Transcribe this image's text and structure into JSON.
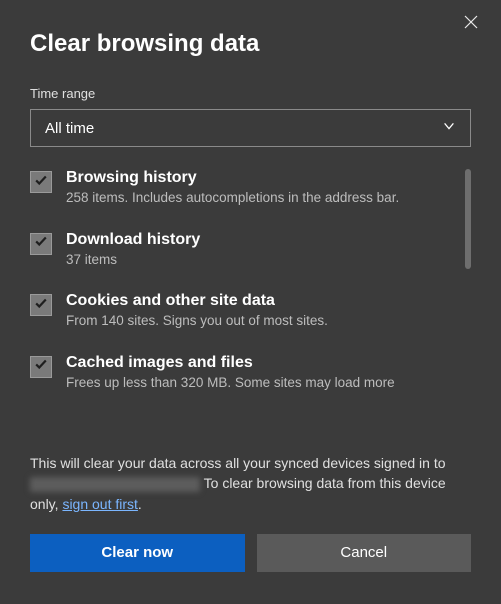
{
  "title": "Clear browsing data",
  "timeRange": {
    "label": "Time range",
    "value": "All time"
  },
  "items": [
    {
      "title": "Browsing history",
      "sub": "258 items. Includes autocompletions in the address bar.",
      "checked": true
    },
    {
      "title": "Download history",
      "sub": "37 items",
      "checked": true
    },
    {
      "title": "Cookies and other site data",
      "sub": "From 140 sites. Signs you out of most sites.",
      "checked": true
    },
    {
      "title": "Cached images and files",
      "sub": "Frees up less than 320 MB. Some sites may load more",
      "checked": true
    }
  ],
  "footer": {
    "part1": "This will clear your data across all your synced devices signed in to",
    "part2": "To clear browsing data from this device only,",
    "link": "sign out first",
    "period": "."
  },
  "buttons": {
    "primary": "Clear now",
    "secondary": "Cancel"
  }
}
